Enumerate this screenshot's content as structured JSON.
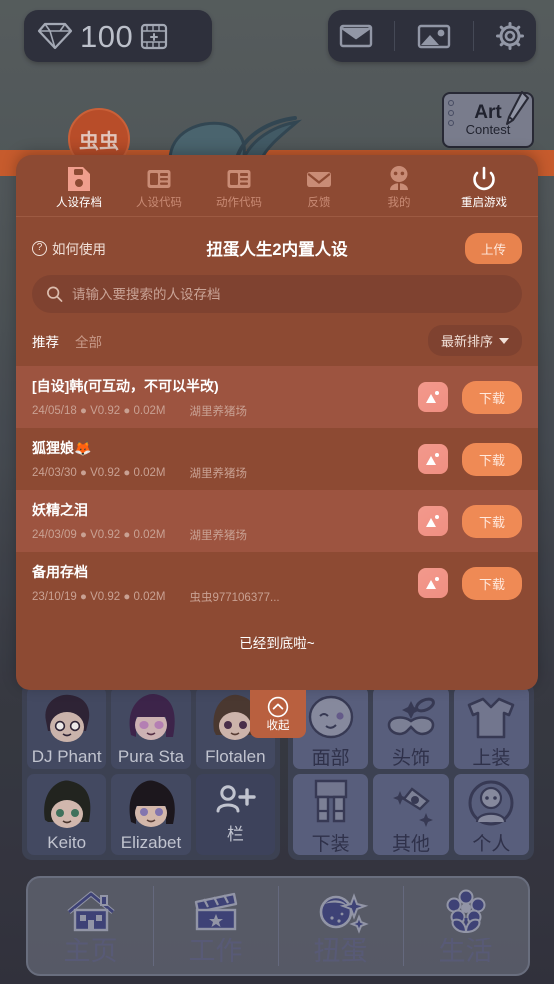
{
  "game_header": {
    "currency": {
      "icon": "diamond-icon",
      "amount": "100",
      "add_icon": "add-currency-icon"
    },
    "icons": [
      {
        "name": "mail-icon",
        "label": "Mail"
      },
      {
        "name": "gallery-icon",
        "label": "Gallery"
      },
      {
        "name": "settings-gear-icon",
        "label": "Settings"
      }
    ],
    "art_contest": {
      "line1": "Art",
      "line2": "Contest"
    },
    "bug_avatar": "虫虫"
  },
  "modal": {
    "nav": [
      {
        "label": "人设存档",
        "icon": "save-file-icon",
        "active": true
      },
      {
        "label": "人设代码",
        "icon": "character-code-icon",
        "active": false
      },
      {
        "label": "动作代码",
        "icon": "action-code-icon",
        "active": false
      },
      {
        "label": "反馈",
        "icon": "envelope-icon",
        "active": false
      },
      {
        "label": "我的",
        "icon": "profile-icon",
        "active": false
      }
    ],
    "restart": {
      "label": "重启游戏",
      "icon": "power-icon"
    },
    "howto": "如何使用",
    "title": "扭蛋人生2内置人设",
    "upload_label": "上传",
    "search": {
      "placeholder": "请输入要搜索的人设存档",
      "value": "",
      "icon": "search-icon"
    },
    "filters": [
      {
        "label": "推荐",
        "active": true
      },
      {
        "label": "全部",
        "active": false
      }
    ],
    "sort": {
      "label": "最新排序",
      "icon": "chevron-down-icon"
    },
    "list_end": "已经到底啦~",
    "saves": [
      {
        "title": "[自设]韩(可互动，不可以半改)",
        "date": "24/05/18",
        "version": "V0.92",
        "size": "0.02M",
        "meta": "24/05/18 ● V0.92 ● 0.02M",
        "author": "湖里养猪场",
        "download_label": "下载",
        "thumb_icon": "image-thumbnail-icon"
      },
      {
        "title": "狐狸娘🦊",
        "date": "24/03/30",
        "version": "V0.92",
        "size": "0.02M",
        "meta": "24/03/30 ● V0.92 ● 0.02M",
        "author": "湖里养猪场",
        "download_label": "下载",
        "thumb_icon": "image-thumbnail-icon"
      },
      {
        "title": "妖精之泪",
        "date": "24/03/09",
        "version": "V0.92",
        "size": "0.02M",
        "meta": "24/03/09 ● V0.92 ● 0.02M",
        "author": "湖里养猪场",
        "download_label": "下载",
        "thumb_icon": "image-thumbnail-icon"
      },
      {
        "title": "备用存档",
        "date": "23/10/19",
        "version": "V0.92",
        "size": "0.02M",
        "meta": "23/10/19 ● V0.92 ● 0.02M",
        "author": "虫虫977106377...",
        "download_label": "下载",
        "thumb_icon": "image-thumbnail-icon"
      }
    ]
  },
  "collapse": {
    "label": "收起",
    "icon": "chevron-up-circle-icon"
  },
  "characters": [
    {
      "name": "DJ Phant"
    },
    {
      "name": "Pura Sta"
    },
    {
      "name": "Flotalen"
    },
    {
      "name": "Keito"
    },
    {
      "name": "Elizabet"
    },
    {
      "name": "栏",
      "icon": "add-person-icon",
      "is_add": true
    }
  ],
  "wardrobe": [
    {
      "label": "面部",
      "icon": "face-icon"
    },
    {
      "label": "头饰",
      "icon": "mask-icon"
    },
    {
      "label": "上装",
      "icon": "shirt-icon"
    },
    {
      "label": "下装",
      "icon": "pants-icon"
    },
    {
      "label": "其他",
      "icon": "wand-icon"
    },
    {
      "label": "个人",
      "icon": "person-circle-icon"
    }
  ],
  "bottom_nav": [
    {
      "label": "主页",
      "icon": "house-icon"
    },
    {
      "label": "工作",
      "icon": "clapperboard-icon"
    },
    {
      "label": "扭蛋",
      "icon": "gacha-planet-icon"
    },
    {
      "label": "生活",
      "icon": "flower-icon"
    }
  ],
  "colors": {
    "modal_bg": "#8d4a33",
    "modal_row_alt": "#9d5440",
    "accent_orange": "#ef8a55",
    "upload_orange": "#e8834e",
    "icon_salmon": "#f3998c",
    "dark_pill": "#2b3240",
    "panel_blue": "#424d69"
  }
}
